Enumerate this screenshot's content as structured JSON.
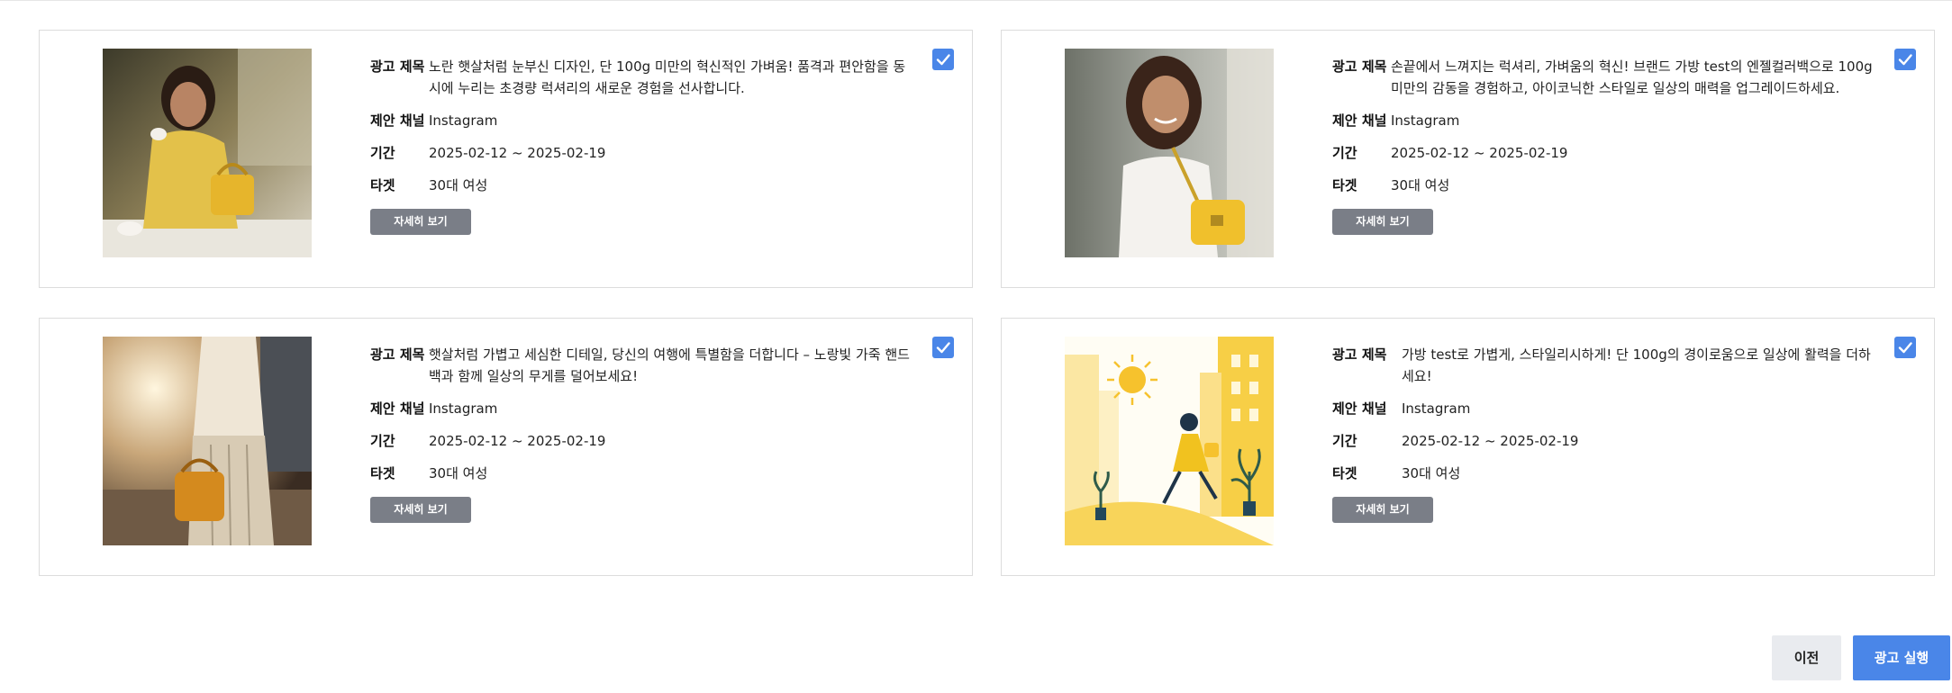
{
  "labels": {
    "ad_title": "광고 제목",
    "channel": "제안 채널",
    "period": "기간",
    "target": "타겟",
    "detail_button": "자세히 보기"
  },
  "cards": [
    {
      "title": "노란 햇살처럼 눈부신 디자인, 단 100g 미만의 혁신적인 가벼움! 품격과 편안함을 동시에 누리는 초경량 럭셔리의 새로운 경험을 선사합니다.",
      "channel": "Instagram",
      "period": "2025-02-12 ~ 2025-02-19",
      "target": "30대 여성",
      "image": "woman-cafe-yellow-bag-photo",
      "checked": true
    },
    {
      "title": "손끝에서 느껴지는 럭셔리, 가벼움의 혁신! 브랜드 가방 test의 엔젤컬러백으로 100g 미만의 감동을 경험하고, 아이코닉한 스타일로 일상의 매력을 업그레이드하세요.",
      "channel": "Instagram",
      "period": "2025-02-12 ~ 2025-02-19",
      "target": "30대 여성",
      "image": "smiling-woman-street-yellow-bag-photo",
      "checked": true
    },
    {
      "title": "햇살처럼 가볍고 세심한 디테일, 당신의 여행에 특별함을 더합니다 – 노랑빛 가죽 핸드백과 함께 일상의 무게를 덜어보세요!",
      "channel": "Instagram",
      "period": "2025-02-12 ~ 2025-02-19",
      "target": "30대 여성",
      "image": "woman-walking-sunlight-handbag-photo",
      "checked": true
    },
    {
      "title": "가방 test로 가볍게, 스타일리시하게! 단 100g의 경이로움으로 일상에 활력을 더하세요!",
      "channel": "Instagram",
      "period": "2025-02-12 ~ 2025-02-19",
      "target": "30대 여성",
      "image": "illustration-woman-yellow-dress-sun",
      "checked": true
    }
  ],
  "footer": {
    "prev_label": "이전",
    "run_label": "광고 실행"
  },
  "colors": {
    "accent": "#4a86e8",
    "detail_button": "#7a7e87",
    "prev_button_bg": "#e9ebef",
    "card_border": "#dcdcdc"
  }
}
